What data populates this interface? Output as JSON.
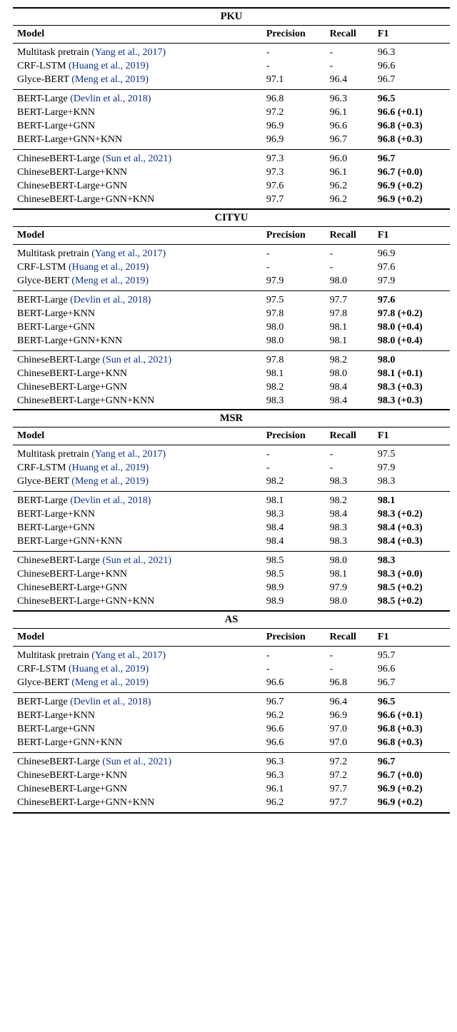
{
  "columns": {
    "model": "Model",
    "precision": "Precision",
    "recall": "Recall",
    "f1": "F1"
  },
  "datasets": [
    {
      "name": "PKU",
      "groups": [
        {
          "rows": [
            {
              "model": "Multitask pretrain",
              "cite": "(Yang et al., 2017)",
              "precision": "-",
              "recall": "-",
              "f1": "96.3",
              "f1_bold": false
            },
            {
              "model": "CRF-LSTM",
              "cite": "(Huang et al., 2019)",
              "precision": "-",
              "recall": "-",
              "f1": "96.6",
              "f1_bold": false
            },
            {
              "model": "Glyce-BERT",
              "cite": "(Meng et al., 2019)",
              "precision": "97.1",
              "recall": "96.4",
              "f1": "96.7",
              "f1_bold": false
            }
          ]
        },
        {
          "rows": [
            {
              "model": "BERT-Large",
              "cite": "(Devlin et al., 2018)",
              "precision": "96.8",
              "recall": "96.3",
              "f1": "96.5",
              "f1_bold": true
            },
            {
              "model": "BERT-Large+KNN",
              "cite": "",
              "precision": "97.2",
              "recall": "96.1",
              "f1": "96.6 (+0.1)",
              "f1_bold": true
            },
            {
              "model": "BERT-Large+GNN",
              "cite": "",
              "precision": "96.9",
              "recall": "96.6",
              "f1": "96.8 (+0.3)",
              "f1_bold": true
            },
            {
              "model": "BERT-Large+GNN+KNN",
              "cite": "",
              "precision": "96.9",
              "recall": "96.7",
              "f1": "96.8 (+0.3)",
              "f1_bold": true
            }
          ]
        },
        {
          "rows": [
            {
              "model": "ChineseBERT-Large",
              "cite": "(Sun et al., 2021)",
              "precision": "97.3",
              "recall": "96.0",
              "f1": "96.7",
              "f1_bold": true
            },
            {
              "model": "ChineseBERT-Large+KNN",
              "cite": "",
              "precision": "97.3",
              "recall": "96.1",
              "f1": "96.7 (+0.0)",
              "f1_bold": true
            },
            {
              "model": "ChineseBERT-Large+GNN",
              "cite": "",
              "precision": "97.6",
              "recall": "96.2",
              "f1": "96.9 (+0.2)",
              "f1_bold": true
            },
            {
              "model": "ChineseBERT-Large+GNN+KNN",
              "cite": "",
              "precision": "97.7",
              "recall": "96.2",
              "f1": "96.9 (+0.2)",
              "f1_bold": true
            }
          ]
        }
      ]
    },
    {
      "name": "CITYU",
      "groups": [
        {
          "rows": [
            {
              "model": "Multitask pretrain",
              "cite": "(Yang et al., 2017)",
              "precision": "-",
              "recall": "-",
              "f1": "96.9",
              "f1_bold": false
            },
            {
              "model": "CRF-LSTM",
              "cite": "(Huang et al., 2019)",
              "precision": "-",
              "recall": "-",
              "f1": "97.6",
              "f1_bold": false
            },
            {
              "model": "Glyce-BERT",
              "cite": "(Meng et al., 2019)",
              "precision": "97.9",
              "recall": "98.0",
              "f1": "97.9",
              "f1_bold": false
            }
          ]
        },
        {
          "rows": [
            {
              "model": "BERT-Large",
              "cite": "(Devlin et al., 2018)",
              "precision": "97.5",
              "recall": "97.7",
              "f1": "97.6",
              "f1_bold": true
            },
            {
              "model": "BERT-Large+KNN",
              "cite": "",
              "precision": "97.8",
              "recall": "97.8",
              "f1": "97.8 (+0.2)",
              "f1_bold": true
            },
            {
              "model": "BERT-Large+GNN",
              "cite": "",
              "precision": "98.0",
              "recall": "98.1",
              "f1": "98.0 (+0.4)",
              "f1_bold": true
            },
            {
              "model": "BERT-Large+GNN+KNN",
              "cite": "",
              "precision": "98.0",
              "recall": "98.1",
              "f1": "98.0 (+0.4)",
              "f1_bold": true
            }
          ]
        },
        {
          "rows": [
            {
              "model": "ChineseBERT-Large",
              "cite": "(Sun et al., 2021)",
              "precision": "97.8",
              "recall": "98.2",
              "f1": "98.0",
              "f1_bold": true
            },
            {
              "model": "ChineseBERT-Large+KNN",
              "cite": "",
              "precision": "98.1",
              "recall": "98.0",
              "f1": "98.1 (+0.1)",
              "f1_bold": true
            },
            {
              "model": "ChineseBERT-Large+GNN",
              "cite": "",
              "precision": "98.2",
              "recall": "98.4",
              "f1": "98.3 (+0.3)",
              "f1_bold": true
            },
            {
              "model": "ChineseBERT-Large+GNN+KNN",
              "cite": "",
              "precision": "98.3",
              "recall": "98.4",
              "f1": "98.3 (+0.3)",
              "f1_bold": true
            }
          ]
        }
      ]
    },
    {
      "name": "MSR",
      "groups": [
        {
          "rows": [
            {
              "model": "Multitask pretrain",
              "cite": "(Yang et al., 2017)",
              "precision": "-",
              "recall": "-",
              "f1": "97.5",
              "f1_bold": false
            },
            {
              "model": "CRF-LSTM",
              "cite": "(Huang et al., 2019)",
              "precision": "-",
              "recall": "-",
              "f1": "97.9",
              "f1_bold": false
            },
            {
              "model": "Glyce-BERT",
              "cite": "(Meng et al., 2019)",
              "precision": "98.2",
              "recall": "98.3",
              "f1": "98.3",
              "f1_bold": false
            }
          ]
        },
        {
          "rows": [
            {
              "model": "BERT-Large",
              "cite": "(Devlin et al., 2018)",
              "precision": "98.1",
              "recall": "98.2",
              "f1": "98.1",
              "f1_bold": true
            },
            {
              "model": "BERT-Large+KNN",
              "cite": "",
              "precision": "98.3",
              "recall": "98.4",
              "f1": "98.3 (+0.2)",
              "f1_bold": true
            },
            {
              "model": "BERT-Large+GNN",
              "cite": "",
              "precision": "98.4",
              "recall": "98.3",
              "f1": "98.4 (+0.3)",
              "f1_bold": true
            },
            {
              "model": "BERT-Large+GNN+KNN",
              "cite": "",
              "precision": "98.4",
              "recall": "98.3",
              "f1": "98.4 (+0.3)",
              "f1_bold": true
            }
          ]
        },
        {
          "rows": [
            {
              "model": "ChineseBERT-Large",
              "cite": "(Sun et al., 2021)",
              "precision": "98.5",
              "recall": "98.0",
              "f1": "98.3",
              "f1_bold": true
            },
            {
              "model": "ChineseBERT-Large+KNN",
              "cite": "",
              "precision": "98.5",
              "recall": "98.1",
              "f1": "98.3 (+0.0)",
              "f1_bold": true
            },
            {
              "model": "ChineseBERT-Large+GNN",
              "cite": "",
              "precision": "98.9",
              "recall": "97.9",
              "f1": "98.5 (+0.2)",
              "f1_bold": true
            },
            {
              "model": "ChineseBERT-Large+GNN+KNN",
              "cite": "",
              "precision": "98.9",
              "recall": "98.0",
              "f1": "98.5 (+0.2)",
              "f1_bold": true
            }
          ]
        }
      ]
    },
    {
      "name": "AS",
      "groups": [
        {
          "rows": [
            {
              "model": "Multitask pretrain",
              "cite": "(Yang et al., 2017)",
              "precision": "-",
              "recall": "-",
              "f1": "95.7",
              "f1_bold": false
            },
            {
              "model": "CRF-LSTM",
              "cite": "(Huang et al., 2019)",
              "precision": "-",
              "recall": "-",
              "f1": "96.6",
              "f1_bold": false
            },
            {
              "model": "Glyce-BERT",
              "cite": "(Meng et al., 2019)",
              "precision": "96.6",
              "recall": "96.8",
              "f1": "96.7",
              "f1_bold": false
            }
          ]
        },
        {
          "rows": [
            {
              "model": "BERT-Large",
              "cite": "(Devlin et al., 2018)",
              "precision": "96.7",
              "recall": "96.4",
              "f1": "96.5",
              "f1_bold": true
            },
            {
              "model": "BERT-Large+KNN",
              "cite": "",
              "precision": "96.2",
              "recall": "96.9",
              "f1": "96.6 (+0.1)",
              "f1_bold": true
            },
            {
              "model": "BERT-Large+GNN",
              "cite": "",
              "precision": "96.6",
              "recall": "97.0",
              "f1": "96.8 (+0.3)",
              "f1_bold": true
            },
            {
              "model": "BERT-Large+GNN+KNN",
              "cite": "",
              "precision": "96.6",
              "recall": "97.0",
              "f1": "96.8 (+0.3)",
              "f1_bold": true
            }
          ]
        },
        {
          "rows": [
            {
              "model": "ChineseBERT-Large",
              "cite": "(Sun et al., 2021)",
              "precision": "96.3",
              "recall": "97.2",
              "f1": "96.7",
              "f1_bold": true
            },
            {
              "model": "ChineseBERT-Large+KNN",
              "cite": "",
              "precision": "96.3",
              "recall": "97.2",
              "f1": "96.7 (+0.0)",
              "f1_bold": true
            },
            {
              "model": "ChineseBERT-Large+GNN",
              "cite": "",
              "precision": "96.1",
              "recall": "97.7",
              "f1": "96.9 (+0.2)",
              "f1_bold": true
            },
            {
              "model": "ChineseBERT-Large+GNN+KNN",
              "cite": "",
              "precision": "96.2",
              "recall": "97.7",
              "f1": "96.9 (+0.2)",
              "f1_bold": true
            }
          ]
        }
      ]
    }
  ]
}
